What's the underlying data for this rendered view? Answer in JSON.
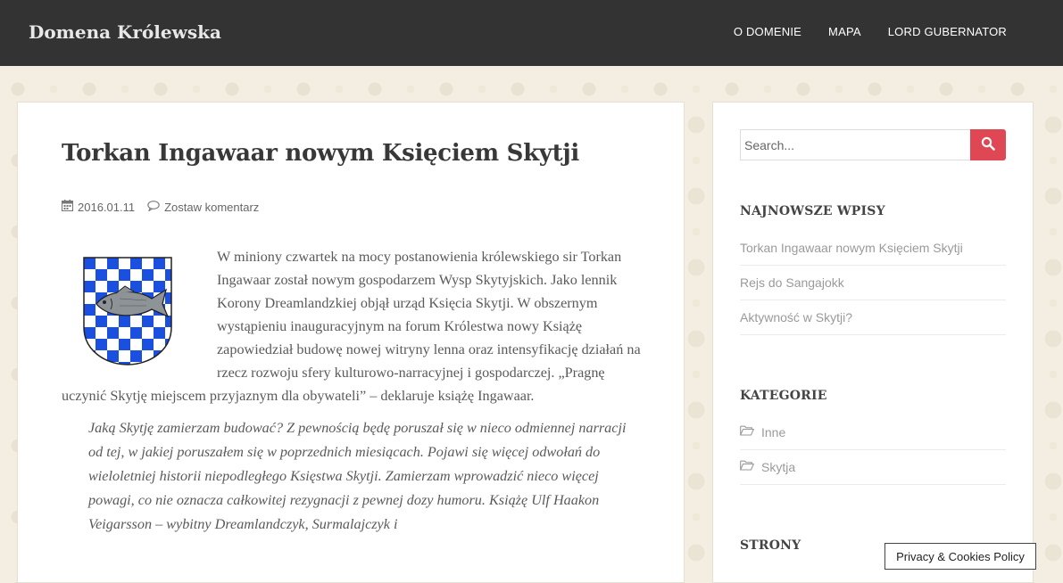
{
  "site": {
    "title": "Domena Królewska"
  },
  "nav": {
    "items": [
      "O DOMENIE",
      "MAPA",
      "LORD GUBERNATOR"
    ]
  },
  "post": {
    "title": "Torkan Ingawaar nowym Księciem Skytji",
    "date": "2016.01.11",
    "comment_link": "Zostaw komentarz",
    "paragraph": "W miniony czwartek na mocy postanowienia królewskiego sir Torkan Ingawaar został nowym gospodarzem Wysp Skytyjskich. Jako lennik Korony Dreamlandzkiej objął urząd Księcia Skytji. W obszernym wystąpieniu inauguracyjnym na forum Królestwa nowy Książę zapowiedział budowę nowej witryny lenna oraz intensyfikację działań na rzecz rozwoju sfery kulturowo-narracyjnej i gospodarczej. „Pragnę uczynić Skytję miejscem przyjaznym dla obywateli” – deklaruje książę Ingawaar.",
    "quote": "Jaką Skytję zamierzam budować? Z pewnością będę poruszał się w nieco odmiennej narracji od tej, w jakiej poruszałem się w poprzednich miesiącach. Pojawi się więcej odwołań do wieloletniej historii niepodległego Księstwa Skytji. Zamierzam wprowadzić nieco więcej powagi, co nie oznacza całkowitej rezygnacji z pewnej dozy humoru. Książę Ulf Haakon Veigarsson – wybitny Dreamlandczyk, Surmalajczyk i"
  },
  "sidebar": {
    "search": {
      "placeholder": "Search..."
    },
    "recent": {
      "title": "NAJNOWSZE WPISY",
      "items": [
        "Torkan Ingawaar nowym Księciem Skytji",
        "Rejs do Sangajokk",
        "Aktywność w Skytji?"
      ]
    },
    "categories": {
      "title": "KATEGORIE",
      "items": [
        "Inne",
        "Skytja"
      ]
    },
    "pages": {
      "title": "STRONY"
    }
  },
  "cookie": {
    "label": "Privacy & Cookies Policy"
  },
  "colors": {
    "topbar": "#333333",
    "accent": "#e04755",
    "coat_blue": "#1a4fe0"
  }
}
